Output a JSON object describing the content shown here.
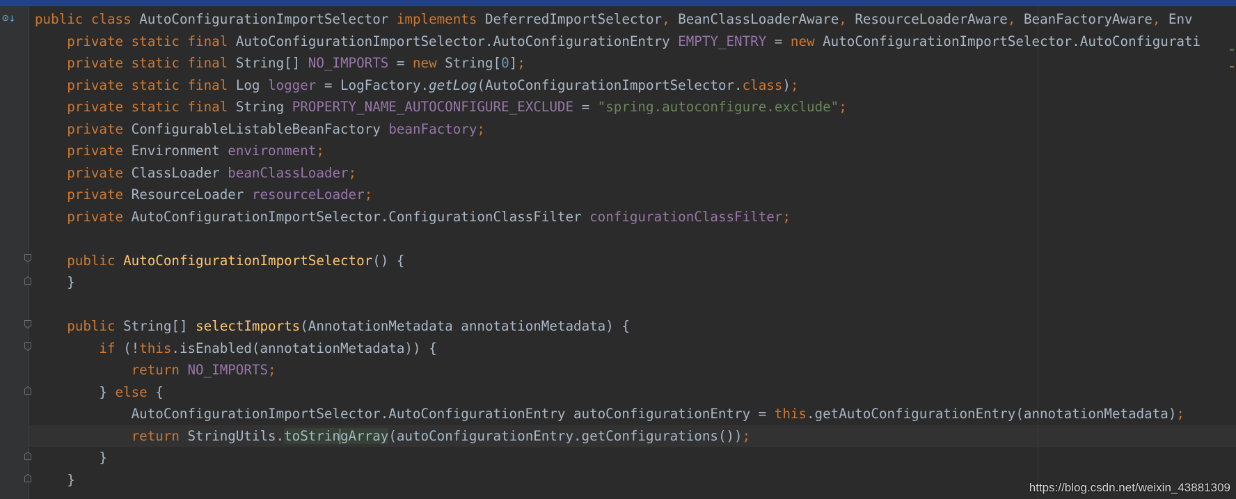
{
  "editor": {
    "lines": [
      [
        [
          "k",
          "public "
        ],
        [
          "k",
          "class "
        ],
        [
          "p",
          "AutoConfigurationImportSelector "
        ],
        [
          "k",
          "implements "
        ],
        [
          "p",
          "DeferredImportSelector"
        ],
        [
          "k",
          ", "
        ],
        [
          "p",
          "BeanClassLoaderAware"
        ],
        [
          "k",
          ", "
        ],
        [
          "p",
          "ResourceLoaderAware"
        ],
        [
          "k",
          ", "
        ],
        [
          "p",
          "BeanFactoryAware"
        ],
        [
          "k",
          ", "
        ],
        [
          "p",
          "Env"
        ]
      ],
      [
        [
          "p",
          "    "
        ],
        [
          "k",
          "private static final "
        ],
        [
          "p",
          "AutoConfigurationImportSelector.AutoConfigurationEntry "
        ],
        [
          "f",
          "EMPTY_ENTRY"
        ],
        [
          "p",
          " = "
        ],
        [
          "k",
          "new "
        ],
        [
          "p",
          "AutoConfigurationImportSelector.AutoConfigurati"
        ]
      ],
      [
        [
          "p",
          "    "
        ],
        [
          "k",
          "private static final "
        ],
        [
          "p",
          "String[] "
        ],
        [
          "f",
          "NO_IMPORTS"
        ],
        [
          "p",
          " = "
        ],
        [
          "k",
          "new "
        ],
        [
          "p",
          "String["
        ],
        [
          "n",
          "0"
        ],
        [
          "p",
          "]"
        ],
        [
          "k",
          ";"
        ]
      ],
      [
        [
          "p",
          "    "
        ],
        [
          "k",
          "private static final "
        ],
        [
          "p",
          "Log "
        ],
        [
          "f",
          "logger"
        ],
        [
          "p",
          " = LogFactory."
        ],
        [
          "i",
          "getLog"
        ],
        [
          "p",
          "(AutoConfigurationImportSelector."
        ],
        [
          "k",
          "class"
        ],
        [
          "p",
          ")"
        ],
        [
          "k",
          ";"
        ]
      ],
      [
        [
          "p",
          "    "
        ],
        [
          "k",
          "private static final "
        ],
        [
          "p",
          "String "
        ],
        [
          "f",
          "PROPERTY_NAME_AUTOCONFIGURE_EXCLUDE"
        ],
        [
          "p",
          " = "
        ],
        [
          "s",
          "\"spring.autoconfigure.exclude\""
        ],
        [
          "k",
          ";"
        ]
      ],
      [
        [
          "p",
          "    "
        ],
        [
          "k",
          "private "
        ],
        [
          "p",
          "ConfigurableListableBeanFactory "
        ],
        [
          "f",
          "beanFactory"
        ],
        [
          "k",
          ";"
        ]
      ],
      [
        [
          "p",
          "    "
        ],
        [
          "k",
          "private "
        ],
        [
          "p",
          "Environment "
        ],
        [
          "f",
          "environment"
        ],
        [
          "k",
          ";"
        ]
      ],
      [
        [
          "p",
          "    "
        ],
        [
          "k",
          "private "
        ],
        [
          "p",
          "ClassLoader "
        ],
        [
          "f",
          "beanClassLoader"
        ],
        [
          "k",
          ";"
        ]
      ],
      [
        [
          "p",
          "    "
        ],
        [
          "k",
          "private "
        ],
        [
          "p",
          "ResourceLoader "
        ],
        [
          "f",
          "resourceLoader"
        ],
        [
          "k",
          ";"
        ]
      ],
      [
        [
          "p",
          "    "
        ],
        [
          "k",
          "private "
        ],
        [
          "p",
          "AutoConfigurationImportSelector.ConfigurationClassFilter "
        ],
        [
          "f",
          "configurationClassFilter"
        ],
        [
          "k",
          ";"
        ]
      ],
      [
        [
          "p",
          ""
        ]
      ],
      [
        [
          "p",
          "    "
        ],
        [
          "k",
          "public "
        ],
        [
          "m",
          "AutoConfigurationImportSelector"
        ],
        [
          "p",
          "() {"
        ]
      ],
      [
        [
          "p",
          "    }"
        ]
      ],
      [
        [
          "p",
          ""
        ]
      ],
      [
        [
          "p",
          "    "
        ],
        [
          "k",
          "public "
        ],
        [
          "p",
          "String[] "
        ],
        [
          "m",
          "selectImports"
        ],
        [
          "p",
          "(AnnotationMetadata annotationMetadata) {"
        ]
      ],
      [
        [
          "p",
          "        "
        ],
        [
          "k",
          "if "
        ],
        [
          "p",
          "(!"
        ],
        [
          "k",
          "this"
        ],
        [
          "p",
          ".isEnabled(annotationMetadata)) {"
        ]
      ],
      [
        [
          "p",
          "            "
        ],
        [
          "k",
          "return "
        ],
        [
          "f",
          "NO_IMPORTS"
        ],
        [
          "k",
          ";"
        ]
      ],
      [
        [
          "p",
          "        } "
        ],
        [
          "k",
          "else "
        ],
        [
          "p",
          "{"
        ]
      ],
      [
        [
          "p",
          "            AutoConfigurationImportSelector.AutoConfigurationEntry autoConfigurationEntry = "
        ],
        [
          "k",
          "this"
        ],
        [
          "p",
          ".getAutoConfigurationEntry(annotationMetadata)"
        ],
        [
          "k",
          ";"
        ]
      ],
      [
        [
          "p",
          "            "
        ],
        [
          "k",
          "return "
        ],
        [
          "p",
          "StringUtils."
        ],
        [
          "h",
          "toStrin"
        ],
        [
          "c",
          ""
        ],
        [
          "h",
          "gArray"
        ],
        [
          "p",
          "(autoConfigurationEntry.getConfigurations())"
        ],
        [
          "k",
          ";"
        ]
      ],
      [
        [
          "p",
          "        }"
        ]
      ],
      [
        [
          "p",
          "    }"
        ]
      ]
    ]
  },
  "gutter": {
    "override_glyph": "⊙↓"
  },
  "watermark": "https://blog.csdn.net/weixin_43881309"
}
